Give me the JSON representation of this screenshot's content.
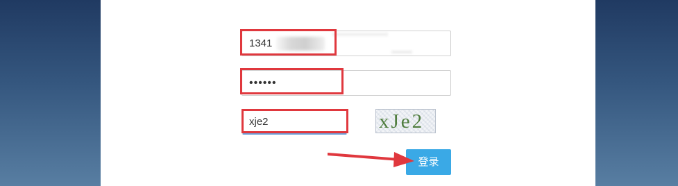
{
  "form": {
    "username_value": "1341",
    "password_value": "••••••",
    "captcha_value": "xje2",
    "captcha_image_text": "xJe2",
    "login_label": "登录"
  },
  "colors": {
    "highlight": "#e0383e",
    "button": "#3aa9e6",
    "captcha_text": "#4f7d3e"
  }
}
